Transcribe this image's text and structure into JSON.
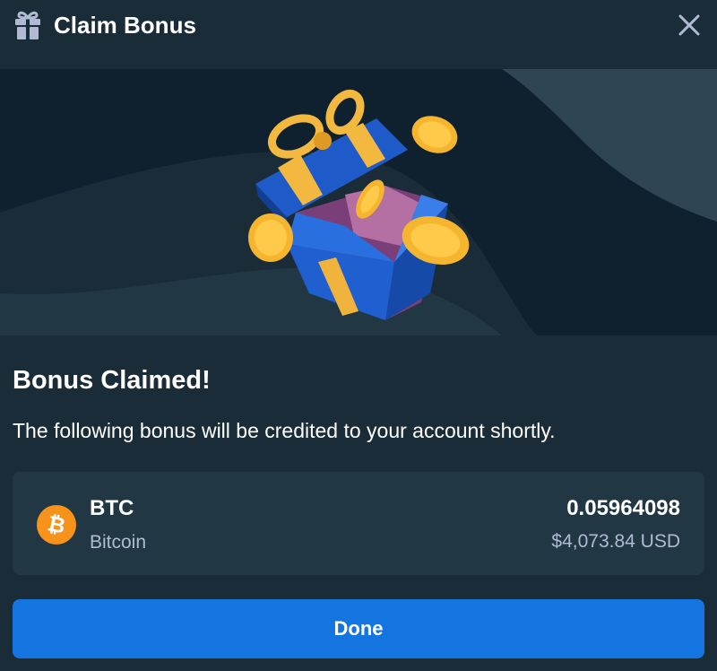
{
  "header": {
    "title": "Claim Bonus",
    "icon": "gift-icon",
    "close_icon": "close-icon"
  },
  "banner": {
    "image": "open-gift-box-with-coins"
  },
  "result": {
    "title": "Bonus Claimed!",
    "description": "The following bonus will be credited to your account shortly."
  },
  "bonus": {
    "icon": "bitcoin-icon",
    "code": "BTC",
    "name": "Bitcoin",
    "amount": "0.05964098",
    "amount_usd": "$4,073.84 USD"
  },
  "actions": {
    "done_label": "Done"
  },
  "colors": {
    "background": "#1a2c38",
    "card": "#213743",
    "banner_dark": "#0f212e",
    "banner_wave": "#2f4553",
    "primary_button": "#1475e1",
    "muted_text": "#b1bad3",
    "bitcoin": "#f7931a"
  }
}
